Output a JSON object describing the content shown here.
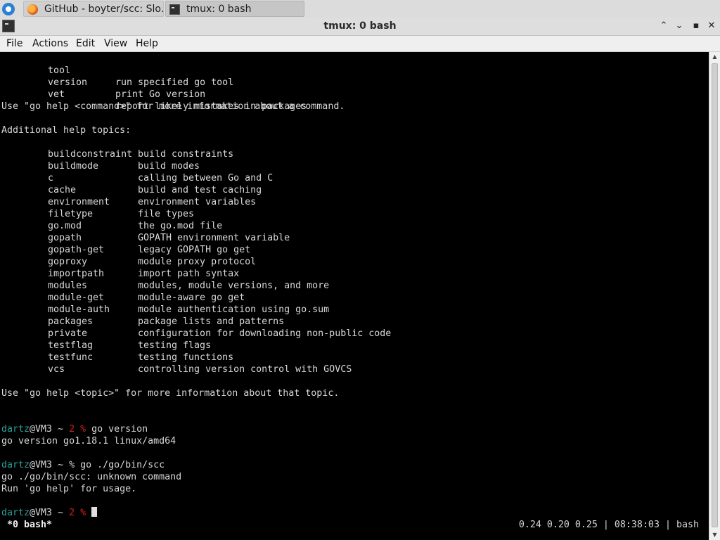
{
  "taskbar": {
    "tasks": [
      {
        "label": "GitHub - boyter/scc: Slo...",
        "icon": "firefox-icon"
      },
      {
        "label": "tmux: 0 bash",
        "icon": "terminal-icon"
      }
    ]
  },
  "window": {
    "title": "tmux: 0 bash",
    "buttons": {
      "minimize": "⌃",
      "restore": "⌄",
      "maximize": "▪",
      "close": "✕"
    }
  },
  "menubar": {
    "items": [
      "File",
      "Actions",
      "Edit",
      "View",
      "Help"
    ]
  },
  "terminal": {
    "top_commands": [
      {
        "name": "tool",
        "desc": "run specified go tool"
      },
      {
        "name": "version",
        "desc": "print Go version"
      },
      {
        "name": "vet",
        "desc": "report likely mistakes in packages"
      }
    ],
    "use_command_line": "Use \"go help <command>\" for more information about a command.",
    "additional_heading": "Additional help topics:",
    "topics": [
      {
        "name": "buildconstraint",
        "desc": "build constraints"
      },
      {
        "name": "buildmode",
        "desc": "build modes"
      },
      {
        "name": "c",
        "desc": "calling between Go and C"
      },
      {
        "name": "cache",
        "desc": "build and test caching"
      },
      {
        "name": "environment",
        "desc": "environment variables"
      },
      {
        "name": "filetype",
        "desc": "file types"
      },
      {
        "name": "go.mod",
        "desc": "the go.mod file"
      },
      {
        "name": "gopath",
        "desc": "GOPATH environment variable"
      },
      {
        "name": "gopath-get",
        "desc": "legacy GOPATH go get"
      },
      {
        "name": "goproxy",
        "desc": "module proxy protocol"
      },
      {
        "name": "importpath",
        "desc": "import path syntax"
      },
      {
        "name": "modules",
        "desc": "modules, module versions, and more"
      },
      {
        "name": "module-get",
        "desc": "module-aware go get"
      },
      {
        "name": "module-auth",
        "desc": "module authentication using go.sum"
      },
      {
        "name": "packages",
        "desc": "package lists and patterns"
      },
      {
        "name": "private",
        "desc": "configuration for downloading non-public code"
      },
      {
        "name": "testflag",
        "desc": "testing flags"
      },
      {
        "name": "testfunc",
        "desc": "testing functions"
      },
      {
        "name": "vcs",
        "desc": "controlling version control with GOVCS"
      }
    ],
    "use_topic_line": "Use \"go help <topic>\" for more information about that topic.",
    "session": {
      "prompt1": {
        "user": "dartz",
        "host": "@VM3 ~ ",
        "status": "2 %",
        "cmd": " go version"
      },
      "out1": "go version go1.18.1 linux/amd64",
      "prompt2": {
        "user": "dartz",
        "host": "@VM3 ~ % ",
        "cmd": "go ./go/bin/scc"
      },
      "out2a": "go ./go/bin/scc: unknown command",
      "out2b": "Run 'go help' for usage.",
      "prompt3": {
        "user": "dartz",
        "host": "@VM3 ~ ",
        "status": "2 %",
        "cmd": " "
      }
    }
  },
  "status": {
    "left": "*0 bash*",
    "right": "0.24 0.20 0.25 | 08:38:03 | bash"
  },
  "colors": {
    "prompt_user": "#2aa198",
    "prompt_status": "#d02020",
    "terminal_bg": "#000000",
    "terminal_fg": "#d8d8d8"
  }
}
